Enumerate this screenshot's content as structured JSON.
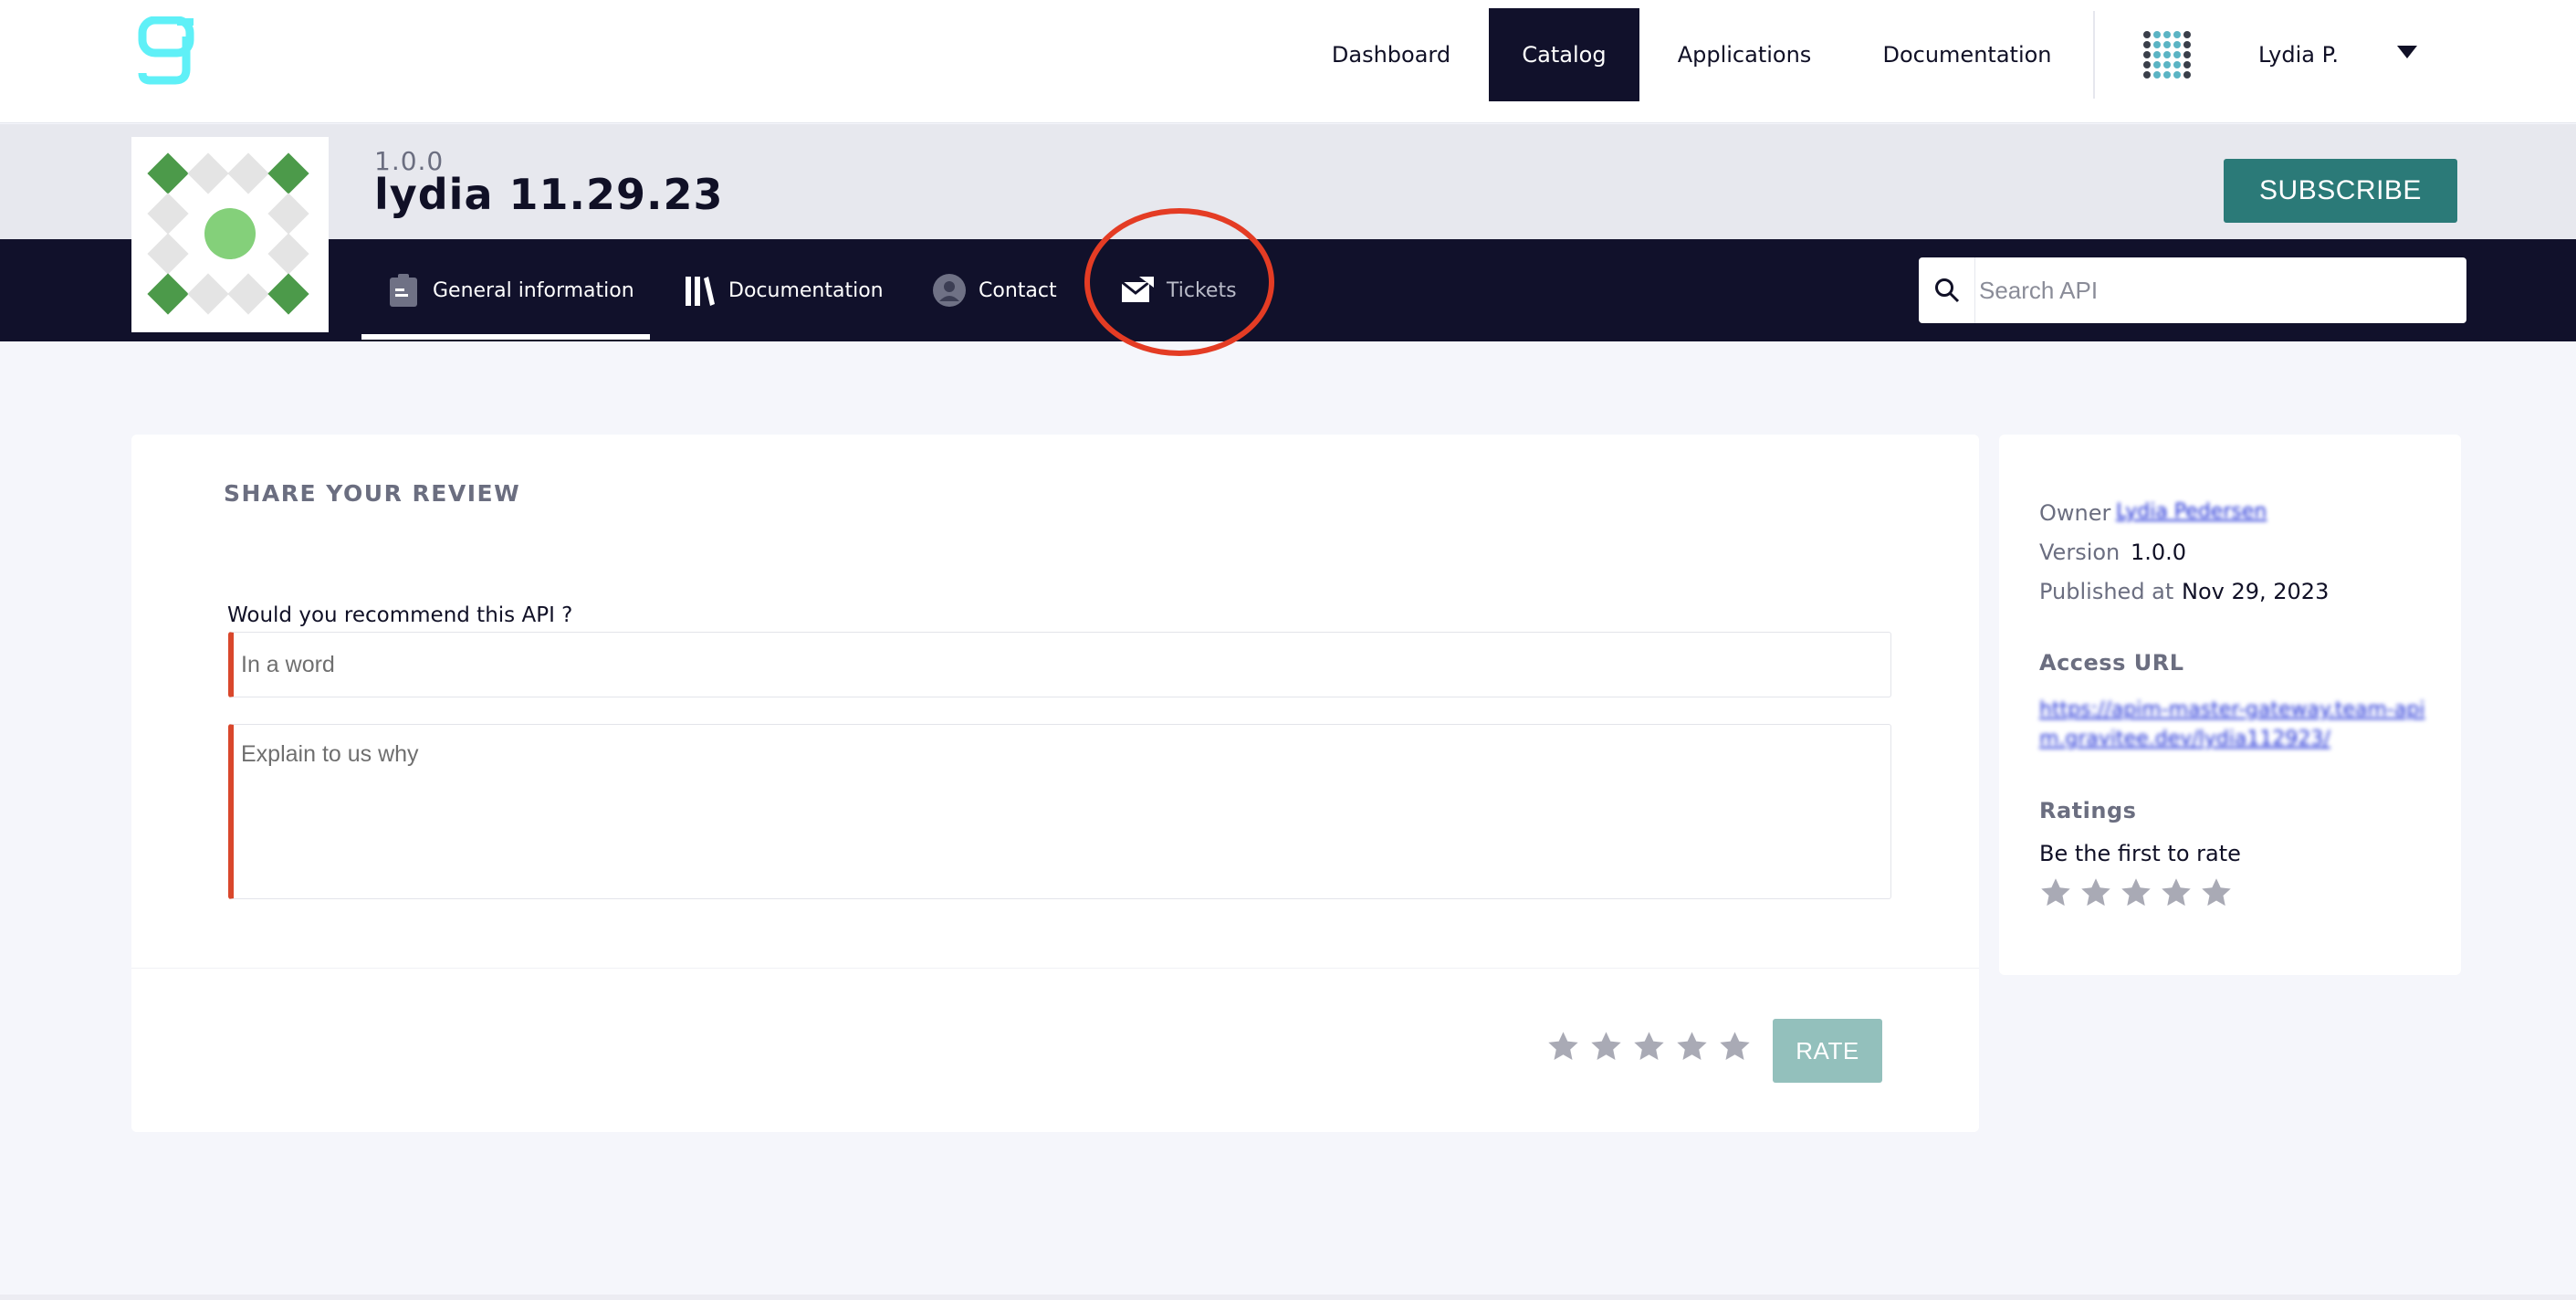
{
  "topnav": {
    "links": [
      {
        "label": "Dashboard",
        "active": false
      },
      {
        "label": "Catalog",
        "active": true
      },
      {
        "label": "Applications",
        "active": false
      },
      {
        "label": "Documentation",
        "active": false
      }
    ],
    "user_name": "Lydia P.",
    "icons": {
      "logo": "gravitee-logo-icon",
      "avatar": "user-avatar-icon",
      "caret": "caret-down-icon"
    }
  },
  "api": {
    "version": "1.0.0",
    "title": "lydia 11.29.23",
    "subscribe_label": "SUBSCRIBE",
    "tabs": [
      {
        "label": "General information",
        "icon": "clipboard-icon",
        "active": true
      },
      {
        "label": "Documentation",
        "icon": "books-icon",
        "active": false
      },
      {
        "label": "Contact",
        "icon": "person-icon",
        "active": false
      },
      {
        "label": "Tickets",
        "icon": "mail-icon",
        "active": false
      }
    ],
    "search_placeholder": "Search API"
  },
  "review": {
    "heading": "SHARE YOUR REVIEW",
    "question": "Would you recommend this API ?",
    "word_placeholder": "In a word",
    "why_placeholder": "Explain to us why",
    "rating": 0,
    "rate_label": "RATE"
  },
  "info": {
    "owner_label": "Owner",
    "owner_value": "Lydia Pedersen",
    "version_label": "Version",
    "version_value": "1.0.0",
    "published_label": "Published at",
    "published_value": "Nov 29, 2023",
    "access_url_heading": "Access URL",
    "access_url": "https://apim-master-gateway.team-apim.gravitee.dev/lydia112923/",
    "ratings_heading": "Ratings",
    "ratings_text": "Be the first to rate",
    "rating": 0
  },
  "colors": {
    "nav_dark": "#11112b",
    "accent": "#2b7a78",
    "rate_disabled": "#93c0bc",
    "required_border": "#d9472c",
    "annotation": "#e43c24"
  }
}
